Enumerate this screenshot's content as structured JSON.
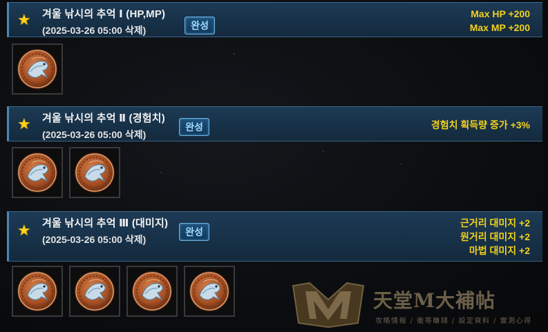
{
  "quests": [
    {
      "title": "겨울 낚시의 추억 Ⅰ (HP,MP)",
      "subtitle": "(2025-03-26 05:00 삭제)",
      "status_label": "완성",
      "effects": [
        "Max HP +200",
        "Max MP +200"
      ],
      "item_icon": "fish-medal-icon",
      "item_count": 1
    },
    {
      "title": "겨울 낚시의 추억 Ⅱ (경험치)",
      "subtitle": "(2025-03-26 05:00 삭제)",
      "status_label": "완성",
      "effects": [
        "경험치 획득량 증가 +3%"
      ],
      "item_icon": "fish-medal-icon",
      "item_count": 2
    },
    {
      "title": "겨울 낚시의 추억 Ⅲ (대미지)",
      "subtitle": "(2025-03-26 05:00 삭제)",
      "status_label": "완성",
      "effects": [
        "근거리 대미지 +2",
        "원거리 대미지 +2",
        "마법 대미지 +2"
      ],
      "item_icon": "fish-medal-icon",
      "item_count": 4
    }
  ],
  "watermark": {
    "title": "天堂M大補帖",
    "subtitle": "攻略情報 / 衝等賺錢 / 設定資料 / 實測心得"
  },
  "colors": {
    "effect_text": "#f2d11c",
    "star": "#ffd21a",
    "badge_text": "#9fdcff",
    "header_bg": "#173148"
  }
}
